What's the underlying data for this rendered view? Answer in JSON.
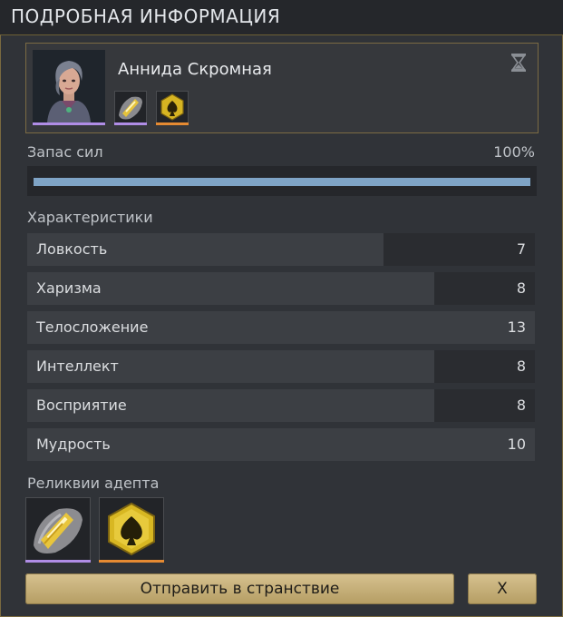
{
  "header": {
    "title": "ПОДРОБНАЯ ИНФОРМАЦИЯ"
  },
  "character": {
    "name": "Аннида Скромная",
    "portrait_icon": "female-adept-portrait",
    "rarity_color": "#b08de6",
    "timer_icon": "hourglass-icon",
    "relics": [
      {
        "icon": "gold-crystal-shard-relic",
        "rarity_color": "#b08de6"
      },
      {
        "icon": "spade-hexagon-relic",
        "rarity_color": "#e58a32"
      }
    ]
  },
  "stamina": {
    "label": "Запас сил",
    "percent_label": "100%",
    "value": 1.0
  },
  "attributes": {
    "title": "Характеристики",
    "items": [
      {
        "label": "Ловкость",
        "value": "7",
        "fill": 0.702
      },
      {
        "label": "Харизма",
        "value": "8",
        "fill": 0.802
      },
      {
        "label": "Телосложение",
        "value": "13",
        "fill": 1.0
      },
      {
        "label": "Интеллект",
        "value": "8",
        "fill": 0.802
      },
      {
        "label": "Восприятие",
        "value": "8",
        "fill": 0.802
      },
      {
        "label": "Мудрость",
        "value": "10",
        "fill": 1.0
      }
    ]
  },
  "relics": {
    "title": "Реликвии адепта",
    "items": [
      {
        "icon": "gold-crystal-shard-relic",
        "rarity_color": "#b08de6"
      },
      {
        "icon": "spade-hexagon-relic",
        "rarity_color": "#e58a32"
      }
    ]
  },
  "buttons": {
    "send": "Отправить в странствие",
    "close": "X"
  }
}
